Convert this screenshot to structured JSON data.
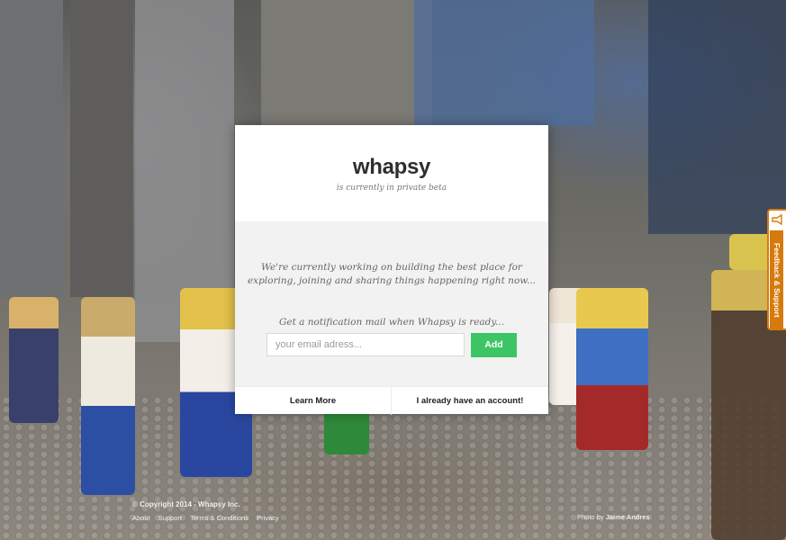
{
  "brand": {
    "logo": "whapsy",
    "tagline": "is currently in private beta"
  },
  "intro": {
    "line1": "We're currently working on building the best place for",
    "line2": "exploring, joining and sharing things happening right now..."
  },
  "signup": {
    "prompt": "Get a notification mail when Whapsy is ready...",
    "email_placeholder": "your email adress...",
    "email_value": "",
    "add_label": "Add"
  },
  "actions": {
    "learn_more": "Learn More",
    "have_account": "I already have an account!"
  },
  "footer": {
    "copyright": "© Copyright 2014 - Whapsy Inc.",
    "links": [
      "About",
      "Support",
      "Terms & Conditions",
      "Privacy"
    ],
    "credit_prefix": "Photo by",
    "credit_name": "Jaime Andres"
  },
  "feedback": {
    "label": "Feedback & Support",
    "icon": "megaphone-icon"
  },
  "colors": {
    "add_button": "#3dc565",
    "feedback_tab": "#d67a0e"
  }
}
